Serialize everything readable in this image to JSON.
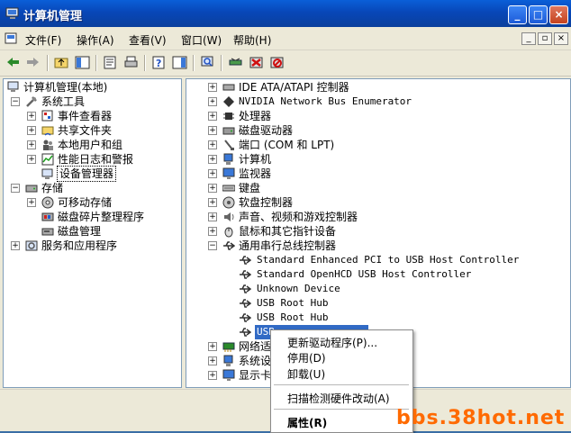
{
  "window": {
    "title": "计算机管理"
  },
  "menu": [
    "文件(F)",
    "操作(A)",
    "查看(V)",
    "窗口(W)",
    "帮助(H)"
  ],
  "left_tree": [
    "计算机管理(本地)",
    "系统工具",
    "事件查看器",
    "共享文件夹",
    "本地用户和组",
    "性能日志和警报",
    "设备管理器",
    "存储",
    "可移动存储",
    "磁盘碎片整理程序",
    "磁盘管理",
    "服务和应用程序"
  ],
  "device_tree": [
    "IDE ATA/ATAPI 控制器",
    "NVIDIA Network Bus Enumerator",
    "处理器",
    "磁盘驱动器",
    "端口 (COM 和 LPT)",
    "计算机",
    "监视器",
    "键盘",
    "软盘控制器",
    "声音、视频和游戏控制器",
    "鼠标和其它指针设备",
    "通用串行总线控制器"
  ],
  "usb_children": [
    "Standard Enhanced PCI to USB Host Controller",
    "Standard OpenHCD USB Host Controller",
    "Unknown Device",
    "USB Root Hub",
    "USB Root Hub",
    "USB"
  ],
  "bottom_tree": [
    "网络适",
    "系统设",
    "显示卡"
  ],
  "context_menu": [
    "更新驱动程序(P)...",
    "停用(D)",
    "卸载(U)",
    "扫描检测硬件改动(A)",
    "属性(R)"
  ],
  "watermark": "bbs.38hot.net"
}
